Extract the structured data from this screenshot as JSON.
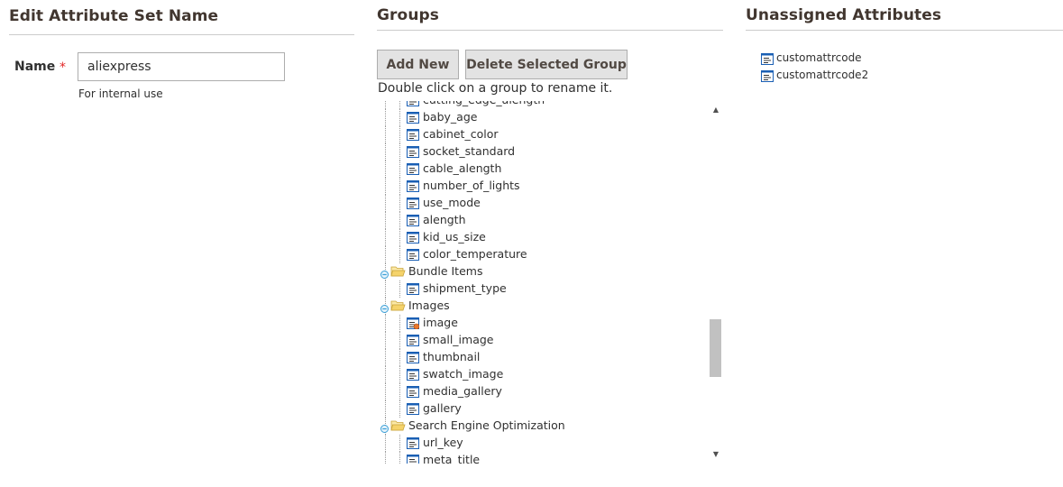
{
  "edit_section": {
    "title": "Edit Attribute Set Name",
    "name_label": "Name",
    "required_mark": "*",
    "name_value": "aliexpress",
    "note": "For internal use"
  },
  "groups_section": {
    "title": "Groups",
    "add_new_label": "Add New",
    "delete_group_label": "Delete Selected Group",
    "hint": "Double click on a group to rename it.",
    "tree": [
      {
        "type": "leaf",
        "label": "cutting_edge_alength",
        "icon": "attribute-icon"
      },
      {
        "type": "leaf",
        "label": "baby_age",
        "icon": "attribute-icon"
      },
      {
        "type": "leaf",
        "label": "cabinet_color",
        "icon": "attribute-icon"
      },
      {
        "type": "leaf",
        "label": "socket_standard",
        "icon": "attribute-icon"
      },
      {
        "type": "leaf",
        "label": "cable_alength",
        "icon": "attribute-icon"
      },
      {
        "type": "leaf",
        "label": "number_of_lights",
        "icon": "attribute-icon"
      },
      {
        "type": "leaf",
        "label": "use_mode",
        "icon": "attribute-icon"
      },
      {
        "type": "leaf",
        "label": "alength",
        "icon": "attribute-icon"
      },
      {
        "type": "leaf",
        "label": "kid_us_size",
        "icon": "attribute-icon"
      },
      {
        "type": "leaf",
        "label": "color_temperature",
        "icon": "attribute-icon"
      },
      {
        "type": "group",
        "label": "Bundle Items",
        "icon": "folder-open-icon"
      },
      {
        "type": "leaf",
        "label": "shipment_type",
        "icon": "attribute-icon"
      },
      {
        "type": "group",
        "label": "Images",
        "icon": "folder-open-icon"
      },
      {
        "type": "leaf",
        "label": "image",
        "icon": "system-attribute-icon"
      },
      {
        "type": "leaf",
        "label": "small_image",
        "icon": "attribute-icon"
      },
      {
        "type": "leaf",
        "label": "thumbnail",
        "icon": "attribute-icon"
      },
      {
        "type": "leaf",
        "label": "swatch_image",
        "icon": "attribute-icon"
      },
      {
        "type": "leaf",
        "label": "media_gallery",
        "icon": "attribute-icon"
      },
      {
        "type": "leaf",
        "label": "gallery",
        "icon": "attribute-icon"
      },
      {
        "type": "group",
        "label": "Search Engine Optimization",
        "icon": "folder-open-icon"
      },
      {
        "type": "leaf",
        "label": "url_key",
        "icon": "attribute-icon"
      },
      {
        "type": "leaf",
        "label": "meta_title",
        "icon": "attribute-icon"
      }
    ]
  },
  "unassigned_section": {
    "title": "Unassigned Attributes",
    "items": [
      {
        "label": "customattrcode",
        "icon": "attribute-icon"
      },
      {
        "label": "customattrcode2",
        "icon": "attribute-icon"
      }
    ]
  },
  "colors": {
    "required": "#e22626",
    "button_bg": "#e3e3e3",
    "icon_blue": "#1a5fb4",
    "folder_yellow": "#f5d36b",
    "toggle_blue": "#3aa0d8"
  }
}
